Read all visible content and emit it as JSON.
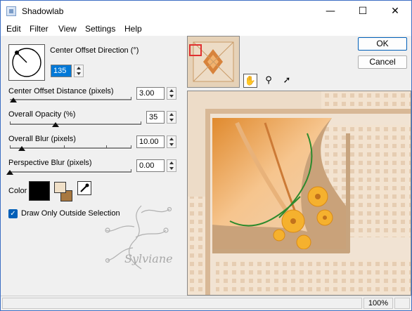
{
  "window": {
    "title": "Shadowlab"
  },
  "menu": [
    "Edit",
    "Filter",
    "View",
    "Settings",
    "Help"
  ],
  "controls": {
    "direction": {
      "label": "Center Offset Direction (°)",
      "value": "135"
    },
    "distance": {
      "label": "Center Offset Distance (pixels)",
      "value": "3.00",
      "slider_fraction": 0.03
    },
    "opacity": {
      "label": "Overall Opacity (%)",
      "value": "35",
      "slider_fraction": 0.35
    },
    "blur": {
      "label": "Overall Blur (pixels)",
      "value": "10.00",
      "slider_fraction": 0.1
    },
    "perspective": {
      "label": "Perspective Blur (pixels)",
      "value": "0.00",
      "slider_fraction": 0.0
    }
  },
  "color": {
    "label": "Color",
    "shadow_color": "#000000",
    "swatch_front": "#f0e0c8",
    "swatch_back": "#a87840",
    "eyedropper_icon": "eyedropper-icon"
  },
  "options": {
    "outside_only_label": "Draw Only Outside Selection",
    "outside_only_checked": true
  },
  "buttons": {
    "ok": "OK",
    "cancel": "Cancel"
  },
  "tools": [
    "pan-icon",
    "zoom-icon",
    "pointer-icon"
  ],
  "watermark": {
    "text": "Sylviane"
  },
  "status": {
    "zoom": "100%"
  }
}
